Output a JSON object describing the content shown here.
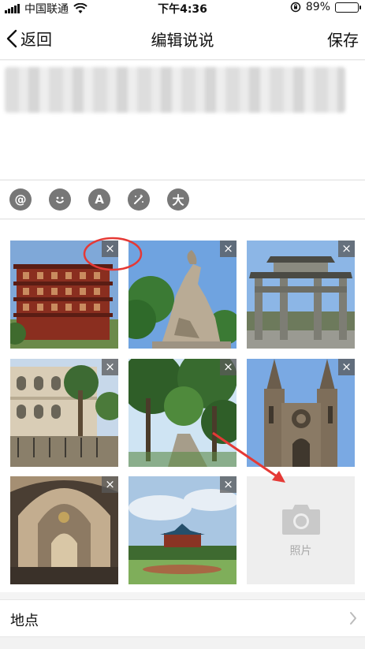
{
  "status_bar": {
    "carrier": "中国联通",
    "time": "下午4:36",
    "battery": "89%",
    "battery_level": 0.89
  },
  "nav": {
    "back_label": "返回",
    "title": "编辑说说",
    "save_label": "保存"
  },
  "toolbar": {
    "icons": [
      "at-icon",
      "emoji-icon",
      "font-icon",
      "magic-wand-icon",
      "large-text-icon"
    ],
    "font_glyph": "A",
    "large_glyph": "大",
    "at_glyph": "@"
  },
  "photos": [
    {
      "subject": "red tower building"
    },
    {
      "subject": "five-goat statue"
    },
    {
      "subject": "stone memorial arch"
    },
    {
      "subject": "colonial arcade building"
    },
    {
      "subject": "tree-lined park path"
    },
    {
      "subject": "gothic cathedral facade"
    },
    {
      "subject": "cathedral interior"
    },
    {
      "subject": "memorial hall and lawn"
    }
  ],
  "delete_glyph": "×",
  "add_photo": {
    "label": "照片"
  },
  "location": {
    "label": "地点"
  },
  "colors": {
    "annotation_red": "#e53935",
    "icon_gray": "#777777",
    "add_tile": "#eeeeee"
  }
}
